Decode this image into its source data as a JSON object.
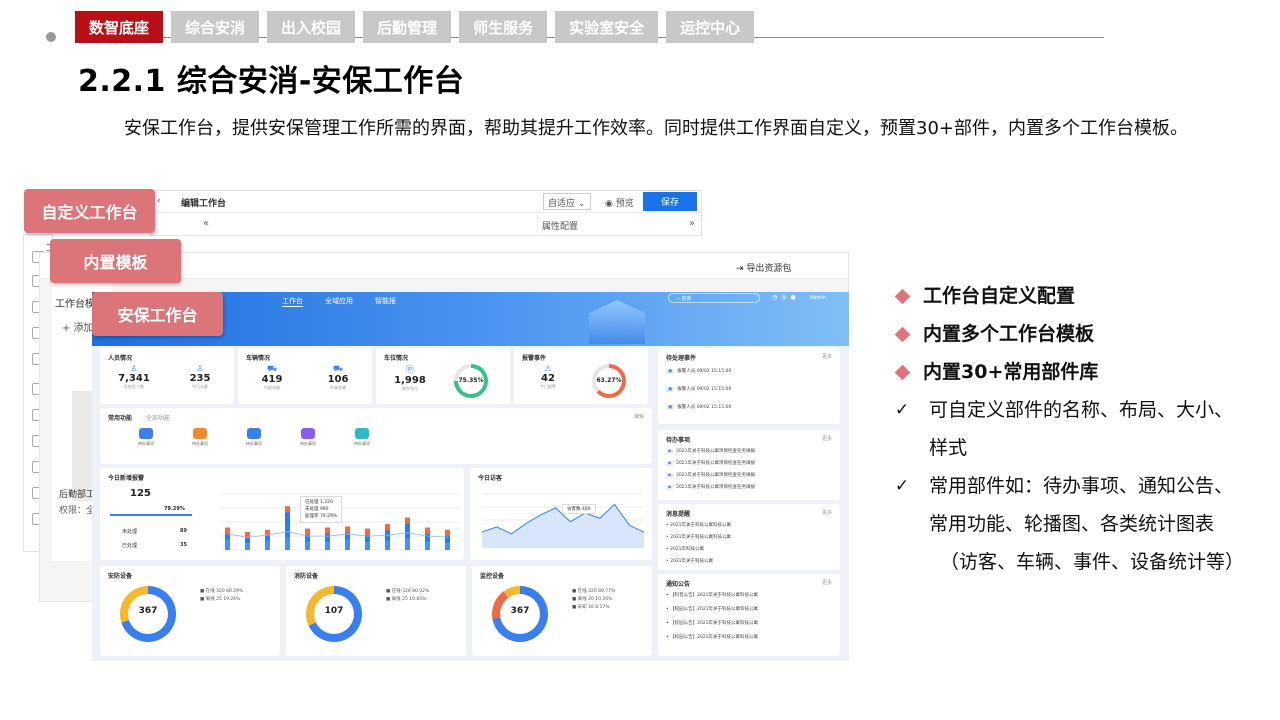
{
  "nav": {
    "tabs": [
      "数智底座",
      "综合安消",
      "出入校园",
      "后勤管理",
      "师生服务",
      "实验室安全",
      "运控中心"
    ],
    "active": 0
  },
  "page": {
    "title": "2.2.1 综合安消-安保工作台",
    "paragraph": "安保工作台，提供安保管理工作所需的界面，帮助其提升工作效率。同时提供工作界面自定义，预置30+部件，内置多个工作台模板。"
  },
  "labels": {
    "custom": "自定义工作台",
    "builtin": "内置模板",
    "security": "安保工作台"
  },
  "editor": {
    "title": "编辑工作台",
    "select": "自适应",
    "preview": "预览",
    "save": "保存",
    "props": "属性配置",
    "export": "导出资源包",
    "list_title": "工作台模板",
    "add": "+ 添加",
    "item_name": "后勤部工作台",
    "item_perm": "权限：全部"
  },
  "dashboard": {
    "nav": [
      "工作台",
      "全域应用",
      "智能报"
    ],
    "search": "搜索",
    "user": "Admin",
    "cards": {
      "people": {
        "title": "人员情况",
        "items": [
          {
            "v": "7,341",
            "k": "在校总人数"
          },
          {
            "v": "235",
            "k": "今日访客"
          }
        ]
      },
      "vehicle": {
        "title": "车辆情况",
        "items": [
          {
            "v": "419",
            "k": "内部车辆"
          },
          {
            "v": "106",
            "k": "外来车辆"
          }
        ]
      },
      "parking": {
        "title": "车位情况",
        "v": "1,998",
        "k": "剩余车位",
        "pct": "75.35%"
      },
      "alarm": {
        "title": "报警事件",
        "v": "42",
        "k": "今日报警",
        "pct": "63.27%"
      },
      "todo": {
        "title": "待处理事件",
        "more": "更多"
      },
      "common": {
        "title": "常用功能",
        "sub": "全部功能",
        "edit": "编辑",
        "items": [
          "待办事项",
          "待办事项",
          "待办事项",
          "待办事项",
          "待办事项"
        ]
      },
      "tasks": {
        "title": "待办事项",
        "more": "更多"
      },
      "newalarm": {
        "title": "今日新增报警",
        "v": "125",
        "pct": "79.29%",
        "a": "89",
        "b": "35",
        "la": "未处理",
        "lb": "已处理"
      },
      "visitor": {
        "title": "今日访客",
        "tip": "访客数",
        "tipv": "400"
      },
      "notice": {
        "title": "消息提醒",
        "more": "更多"
      },
      "announce": {
        "title": "通知公告",
        "more": "更多"
      },
      "security": {
        "title": "安防设备",
        "v": "367",
        "k": "设备总数(台)"
      },
      "fire": {
        "title": "消防设备",
        "v": "107",
        "k": "设备总数(台)"
      },
      "monitor": {
        "title": "监控设备",
        "v": "367",
        "k": "设备总数(台)"
      }
    },
    "todo_list": [
      "报警人员 09/02 15:15:00",
      "报警人员 09/02 15:15:00",
      "报警人员 09/02 15:15:00"
    ],
    "task_list": [
      "2021年关于科技公寓项目检查任务填报",
      "2021年关于科技公寓项目检查任务填报",
      "2021年关于科技公寓项目检查任务填报",
      "2021年关于科技公寓项目检查任务填报"
    ],
    "notice_list": [
      "2021年关于科技公寓科技公寓",
      "2021年关于科技公寓科技公寓",
      "2021年科技公寓",
      "2021年关于科技公寓"
    ],
    "announce_list": [
      "【科普公告】2021年关于科技公寓科技公寓",
      "【校园公告】2021年关于科技公寓科技公寓",
      "【校园公告】2021年关于科技公寓科技公寓",
      "【校园公告】2021年关于科技公寓科技公寓"
    ],
    "alarm_tip": [
      {
        "k": "已处理",
        "v": "1,220"
      },
      {
        "k": "未处理",
        "v": "990"
      },
      {
        "k": "处理率",
        "v": "79.29%"
      }
    ]
  },
  "chart_data": {
    "type": "bar",
    "categories": [
      "1",
      "2",
      "3",
      "4",
      "5",
      "6",
      "7",
      "8",
      "9",
      "10",
      "11",
      "12"
    ],
    "series": [
      {
        "values": [
          40,
          32,
          36,
          78,
          38,
          40,
          42,
          38,
          46,
          58,
          40,
          36
        ]
      },
      {
        "values": [
          18,
          12,
          16,
          22,
          14,
          14,
          18,
          14,
          16,
          20,
          14,
          12
        ]
      }
    ]
  },
  "visitor_chart": {
    "type": "line",
    "values": [
      380,
      410,
      370,
      430,
      480,
      520,
      440,
      490,
      460,
      540,
      420,
      380
    ]
  },
  "bullets": [
    {
      "type": "diamond",
      "text": "工作台自定义配置",
      "bold": true
    },
    {
      "type": "diamond",
      "text": "内置多个工作台模板",
      "bold": true
    },
    {
      "type": "diamond",
      "text": "内置30+常用部件库",
      "bold": true
    },
    {
      "type": "check",
      "text": "可自定义部件的名称、布局、大小、"
    },
    {
      "type": "none",
      "text": "样式"
    },
    {
      "type": "check",
      "text": "常用部件如：待办事项、通知公告、"
    },
    {
      "type": "none",
      "text": "常用功能、轮播图、各类统计图表"
    },
    {
      "type": "none",
      "text": "（访客、车辆、事件、设备统计等）"
    }
  ]
}
